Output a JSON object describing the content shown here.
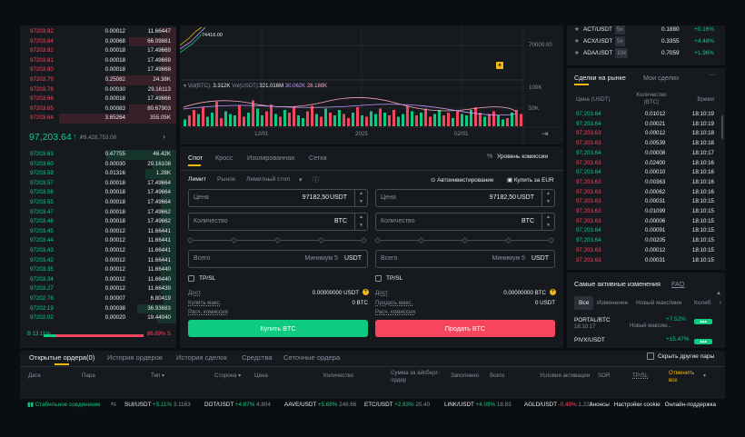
{
  "orderbook": {
    "asks": [
      {
        "price": "97203.92",
        "amount": "0.00012",
        "total": "11.66447",
        "depth": 0.1
      },
      {
        "price": "97203.84",
        "amount": "0.00068",
        "total": "66.09861",
        "depth": 0.3
      },
      {
        "price": "97203.82",
        "amount": "0.00018",
        "total": "17.49669",
        "depth": 0.1
      },
      {
        "price": "97203.81",
        "amount": "0.00018",
        "total": "17.49669",
        "depth": 0.1
      },
      {
        "price": "97203.80",
        "amount": "0.00018",
        "total": "17.49668",
        "depth": 0.1
      },
      {
        "price": "97203.79",
        "amount": "0.25082",
        "total": "24.38K",
        "depth": 0.45
      },
      {
        "price": "97203.78",
        "amount": "0.00030",
        "total": "29.16113",
        "depth": 0.15
      },
      {
        "price": "97203.66",
        "amount": "0.00018",
        "total": "17.49666",
        "depth": 0.1
      },
      {
        "price": "97203.65",
        "amount": "0.00083",
        "total": "80.67903",
        "depth": 0.3
      },
      {
        "price": "97203.64",
        "amount": "3.65264",
        "total": "355.05K",
        "depth": 0.75
      }
    ],
    "last_price": "97,203.64",
    "last_price_arrow": "↑",
    "mark_price": "₽9,428,753.08",
    "bids": [
      {
        "price": "97203.63",
        "amount": "0.47755",
        "total": "46.42K",
        "depth": 0.45
      },
      {
        "price": "97203.60",
        "amount": "0.00030",
        "total": "29.16108",
        "depth": 0.15
      },
      {
        "price": "97203.59",
        "amount": "0.01316",
        "total": "1.28K",
        "depth": 0.2
      },
      {
        "price": "97203.57",
        "amount": "0.00018",
        "total": "17.49664",
        "depth": 0.1
      },
      {
        "price": "97203.56",
        "amount": "0.00018",
        "total": "17.49664",
        "depth": 0.1
      },
      {
        "price": "97203.55",
        "amount": "0.00018",
        "total": "17.49664",
        "depth": 0.1
      },
      {
        "price": "97203.47",
        "amount": "0.00018",
        "total": "17.49662",
        "depth": 0.1
      },
      {
        "price": "97203.46",
        "amount": "0.00018",
        "total": "17.49662",
        "depth": 0.1
      },
      {
        "price": "97203.45",
        "amount": "0.00012",
        "total": "11.66441",
        "depth": 0.1
      },
      {
        "price": "97203.44",
        "amount": "0.00012",
        "total": "11.66441",
        "depth": 0.1
      },
      {
        "price": "97203.43",
        "amount": "0.00012",
        "total": "11.66441",
        "depth": 0.1
      },
      {
        "price": "97203.42",
        "amount": "0.00012",
        "total": "11.66441",
        "depth": 0.1
      },
      {
        "price": "97203.35",
        "amount": "0.00012",
        "total": "11.66440",
        "depth": 0.1
      },
      {
        "price": "97203.34",
        "amount": "0.00012",
        "total": "11.66440",
        "depth": 0.1
      },
      {
        "price": "97203.27",
        "amount": "0.00012",
        "total": "11.66439",
        "depth": 0.1
      },
      {
        "price": "97202.78",
        "amount": "0.00007",
        "total": "6.80419",
        "depth": 0.08
      },
      {
        "price": "97202.19",
        "amount": "0.00038",
        "total": "36.93683",
        "depth": 0.25
      },
      {
        "price": "97202.02",
        "amount": "0.00020",
        "total": "19.44040",
        "depth": 0.12
      }
    ],
    "buy_ratio_label": "B 13.11%",
    "sell_ratio_label": "86.89% S",
    "buy_ratio": 0.1311
  },
  "chart": {
    "top_label": "74416.00",
    "price_tick": "70000.00",
    "vol_legend_prefix": "Vol(BTC):",
    "vol_btc": "3.312K",
    "vol_usdt_prefix": "Vol(USDT):",
    "vol_usdt": "321.016M",
    "ma1": "30.062K",
    "ma2": "28.188K",
    "vol_ticks": [
      "100K",
      "50K"
    ],
    "x_labels": [
      "12/01",
      "2025",
      "02/01"
    ],
    "vol_bars": [
      5,
      8,
      12,
      9,
      14,
      7,
      10,
      18,
      6,
      11,
      9,
      8,
      15,
      7,
      10,
      19,
      13,
      8,
      11,
      16,
      9,
      7,
      12,
      10,
      14,
      8,
      6,
      11,
      15,
      9,
      7,
      13,
      10,
      8,
      12,
      9,
      6,
      10,
      14,
      8,
      7,
      11,
      9,
      13,
      10,
      8,
      12,
      7,
      9,
      15,
      11,
      8,
      10,
      13,
      7,
      9,
      12,
      8,
      10,
      6,
      11,
      9,
      8,
      12,
      14,
      10,
      7,
      9,
      11,
      8,
      5,
      6,
      10,
      12,
      9
    ],
    "vol_colors": "grrgrggrrgggrrgrggrrgrgrrggrrgrgrggrrgrgrggrgrrggrgrgrrggrrgrgggrrgrrggrg"
  },
  "trade": {
    "tabs": [
      "Спот",
      "Кросс",
      "Изолированная",
      "Сетка"
    ],
    "fee_level": "Уровень комиссии",
    "order_types": [
      "Лимит",
      "Рынок",
      "Лимитный стоп"
    ],
    "auto_invest": "Автоинвестирование",
    "buy_eur": "Купить за EUR",
    "price_label": "Цена",
    "price_value": "97182,50",
    "price_unit": "USDT",
    "qty_label": "Количество",
    "qty_unit": "BTC",
    "total_label": "Всего",
    "total_min": "Минимум 5",
    "total_unit": "USDT",
    "tpsl": "TP/SL",
    "avail_label": "Дост.",
    "avail_buy": "0.00000000 USDT",
    "avail_sell": "0.00000000 BTC",
    "max_buy_label": "Купить макс.",
    "max_buy": "0 BTC",
    "max_sell_label": "Продать макс.",
    "max_sell": "0 USDT",
    "fee_calc": "Расч. комиссия",
    "buy_btn": "Купить BTC",
    "sell_btn": "Продать BTC",
    "buy_color": "#0ecb81",
    "sell_color": "#f6465d"
  },
  "watchlist": [
    {
      "pair": "ACT/USDT",
      "lev": "5x",
      "price": "0.1880",
      "change": "+0.16%"
    },
    {
      "pair": "ACX/USDT",
      "lev": "5x",
      "price": "0.3355",
      "change": "+4.48%"
    },
    {
      "pair": "ADA/USDT",
      "lev": "10x",
      "price": "0.7059",
      "change": "+1.96%"
    }
  ],
  "market_trades": {
    "tabs": [
      "Сделки на рынке",
      "Мои сделки"
    ],
    "headers": [
      "Цена (USDT)",
      "Количество (BTC)",
      "Время"
    ],
    "rows": [
      {
        "p": "97,203.64",
        "q": "0.01012",
        "t": "18:10:19",
        "s": "g"
      },
      {
        "p": "97,203.64",
        "q": "0.00021",
        "t": "18:10:19",
        "s": "g"
      },
      {
        "p": "97,203.63",
        "q": "0.00012",
        "t": "18:10:18",
        "s": "r"
      },
      {
        "p": "97,203.63",
        "q": "0.00539",
        "t": "18:10:18",
        "s": "r"
      },
      {
        "p": "97,203.64",
        "q": "0.00008",
        "t": "18:10:17",
        "s": "g"
      },
      {
        "p": "97,203.63",
        "q": "0.02400",
        "t": "18:10:16",
        "s": "r"
      },
      {
        "p": "97,203.64",
        "q": "0.00010",
        "t": "18:10:16",
        "s": "g"
      },
      {
        "p": "97,203.63",
        "q": "0.00363",
        "t": "18:10:16",
        "s": "r"
      },
      {
        "p": "97,203.63",
        "q": "0.00062",
        "t": "18:10:16",
        "s": "r"
      },
      {
        "p": "97,203.63",
        "q": "0.00031",
        "t": "18:10:15",
        "s": "r"
      },
      {
        "p": "97,203.63",
        "q": "0.01099",
        "t": "18:10:15",
        "s": "r"
      },
      {
        "p": "97,203.63",
        "q": "0.00006",
        "t": "18:10:15",
        "s": "r"
      },
      {
        "p": "97,203.64",
        "q": "0.00091",
        "t": "18:10:15",
        "s": "g"
      },
      {
        "p": "97,203.64",
        "q": "0.00205",
        "t": "18:10:15",
        "s": "g"
      },
      {
        "p": "97,203.63",
        "q": "0.00012",
        "t": "18:10:15",
        "s": "r"
      },
      {
        "p": "97,203.63",
        "q": "0.00031",
        "t": "18:10:15",
        "s": "r"
      }
    ]
  },
  "movers": {
    "title": "Самые активные изменения",
    "faq": "FAQ",
    "tabs": [
      "Все",
      "Изменение",
      "Новый макс/мин",
      "Колеб"
    ],
    "items": [
      {
        "pair": "PORTAL/BTC",
        "time": "18:10:17",
        "change": "+7.52%",
        "desc": "Новый максим..."
      },
      {
        "pair": "PIVX/USDT",
        "time": "",
        "change": "+15.47%",
        "desc": ""
      }
    ]
  },
  "orders": {
    "tabs": [
      "Открытые ордера(0)",
      "История ордеров",
      "История сделок",
      "Средства",
      "Сеточные ордера"
    ],
    "hide_pairs": "Скрыть другие пары",
    "cols": [
      "Дата",
      "Пара",
      "Тип",
      "Сторона",
      "Цена",
      "Количество",
      "Сумма за айсберг-ордер",
      "Заполнено",
      "Всего",
      "Условия активации",
      "SOR",
      "TP/SL",
      "Отменить все"
    ]
  },
  "ticker": {
    "status": "Стабильное соединение",
    "items": [
      {
        "pair": "SUI/USDT",
        "change": "+5.11%",
        "price": "3.1163",
        "s": "g"
      },
      {
        "pair": "DOT/USDT",
        "change": "+4.87%",
        "price": "4.804",
        "s": "g"
      },
      {
        "pair": "AAVE/USDT",
        "change": "+5.68%",
        "price": "248.66",
        "s": "g"
      },
      {
        "pair": "ETC/USDT",
        "change": "+2.93%",
        "price": "20.40",
        "s": "g"
      },
      {
        "pair": "LINK/USDT",
        "change": "+4.09%",
        "price": "18.83",
        "s": "g"
      },
      {
        "pair": "AGLD/USDT",
        "change": "-0.49%",
        "price": "1.223",
        "s": "r"
      }
    ],
    "links": [
      "Анонсы",
      "Настройки cookie",
      "Онлайн-поддержка"
    ]
  }
}
